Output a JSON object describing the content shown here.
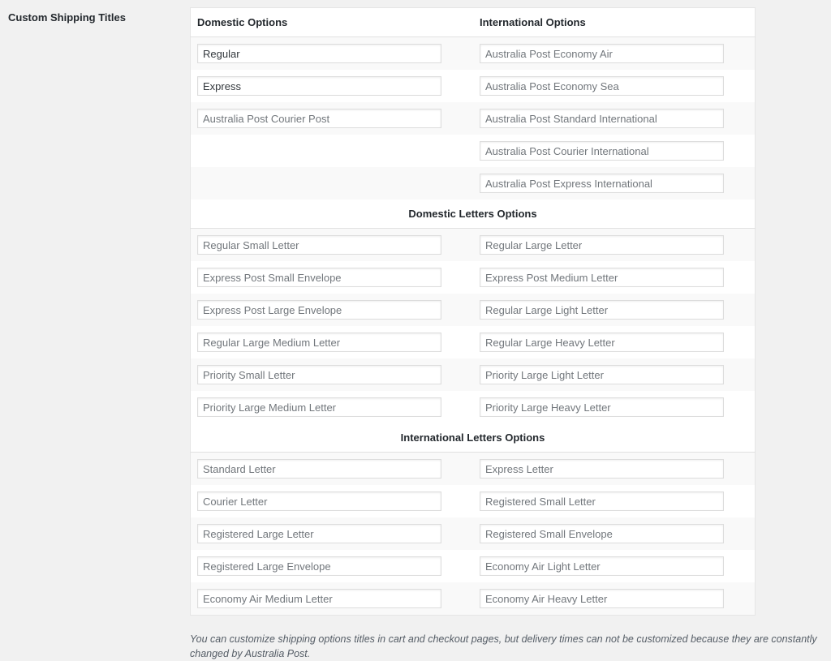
{
  "setting_label": "Custom Shipping Titles",
  "columns": {
    "domestic": "Domestic Options",
    "international": "International Options"
  },
  "parcel_rows": [
    {
      "domestic": {
        "value": "Regular",
        "placeholder": ""
      },
      "international": {
        "value": "",
        "placeholder": "Australia Post Economy Air"
      }
    },
    {
      "domestic": {
        "value": "Express",
        "placeholder": ""
      },
      "international": {
        "value": "",
        "placeholder": "Australia Post Economy Sea"
      }
    },
    {
      "domestic": {
        "value": "",
        "placeholder": "Australia Post Courier Post"
      },
      "international": {
        "value": "",
        "placeholder": "Australia Post Standard International"
      }
    },
    {
      "domestic": null,
      "international": {
        "value": "",
        "placeholder": "Australia Post Courier International"
      }
    },
    {
      "domestic": null,
      "international": {
        "value": "",
        "placeholder": "Australia Post Express International"
      }
    }
  ],
  "domestic_letters": {
    "title": "Domestic Letters Options",
    "rows": [
      [
        "Regular Small Letter",
        "Regular Large Letter"
      ],
      [
        "Express Post Small Envelope",
        "Express Post Medium Letter"
      ],
      [
        "Express Post Large Envelope",
        "Regular Large Light Letter"
      ],
      [
        "Regular Large Medium Letter",
        "Regular Large Heavy Letter"
      ],
      [
        "Priority Small Letter",
        "Priority Large Light Letter"
      ],
      [
        "Priority Large Medium Letter",
        "Priority Large Heavy Letter"
      ]
    ]
  },
  "international_letters": {
    "title": "International Letters Options",
    "rows": [
      [
        "Standard Letter",
        "Express Letter"
      ],
      [
        "Courier Letter",
        "Registered Small Letter"
      ],
      [
        "Registered Large Letter",
        "Registered Small Envelope"
      ],
      [
        "Registered Large Envelope",
        "Economy Air Light Letter"
      ],
      [
        "Economy Air Medium Letter",
        "Economy Air Heavy Letter"
      ]
    ]
  },
  "description": "You can customize shipping options titles in cart and checkout pages, but delivery times can not be customized because they are constantly changed by Australia Post."
}
